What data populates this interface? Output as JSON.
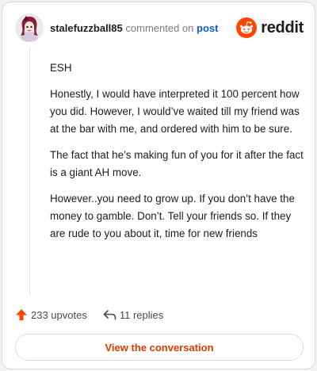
{
  "header": {
    "username": "stalefuzzball85",
    "action": "commented on",
    "target": "post",
    "brand": "reddit",
    "brand_color": "#ff4500",
    "avatar_icon": "user-avatar"
  },
  "comment": {
    "paragraphs": [
      "ESH",
      "Honestly, I would have interpreted it 100 percent how you did. However, I would’ve waited till my friend was at the bar with me, and ordered with him to be sure.",
      "The fact that he’s making fun of you for it after the fact is a giant AH move.",
      "However..you need to grow up. If you don’t have the money to gamble. Don’t. Tell your friends so. If they are rude to you about it, time for new friends"
    ]
  },
  "footer": {
    "upvotes_label": "233 upvotes",
    "replies_label": "11 replies",
    "upvote_color": "#ff4500"
  },
  "cta": {
    "label": "View the conversation",
    "color": "#d93a00"
  }
}
